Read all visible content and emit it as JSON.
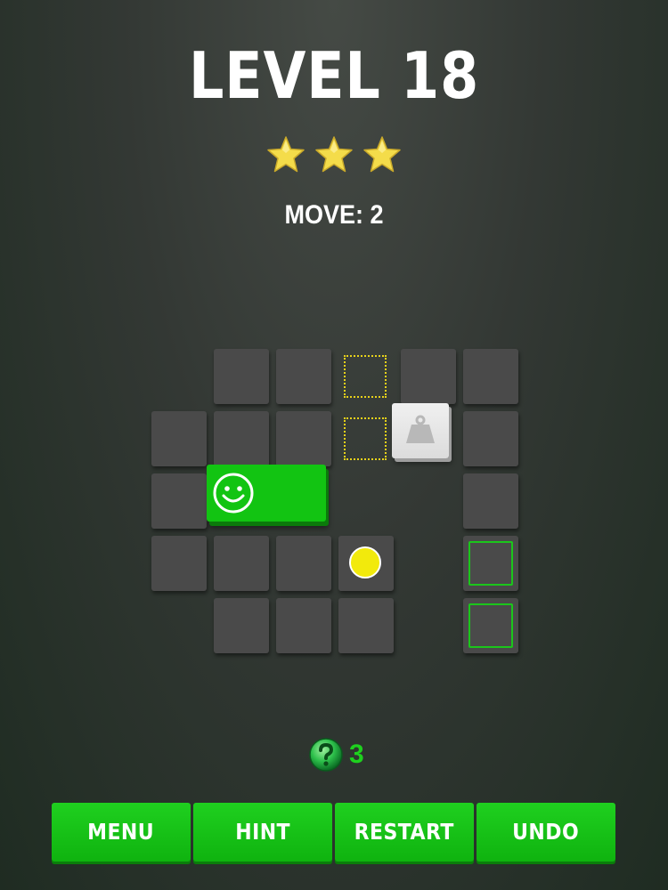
{
  "header": {
    "title": "LEVEL 18",
    "stars_earned": 3,
    "stars_total": 3,
    "moves_text": "MOVE: 2"
  },
  "board": {
    "tile_color": "#4a4a4a",
    "player_color": "#12c412",
    "target_color": "#e8d21a",
    "goal_color": "#1bc61b",
    "pieces": [
      "smiley-block",
      "weight-block",
      "yellow-ball"
    ]
  },
  "hints": {
    "icon": "question-hint-icon",
    "count": "3"
  },
  "buttons": {
    "menu": "MENU",
    "hint": "HINT",
    "restart": "RESTART",
    "undo": "UNDO"
  },
  "colors": {
    "accent": "#12c412",
    "star": "#f4dc4a"
  }
}
